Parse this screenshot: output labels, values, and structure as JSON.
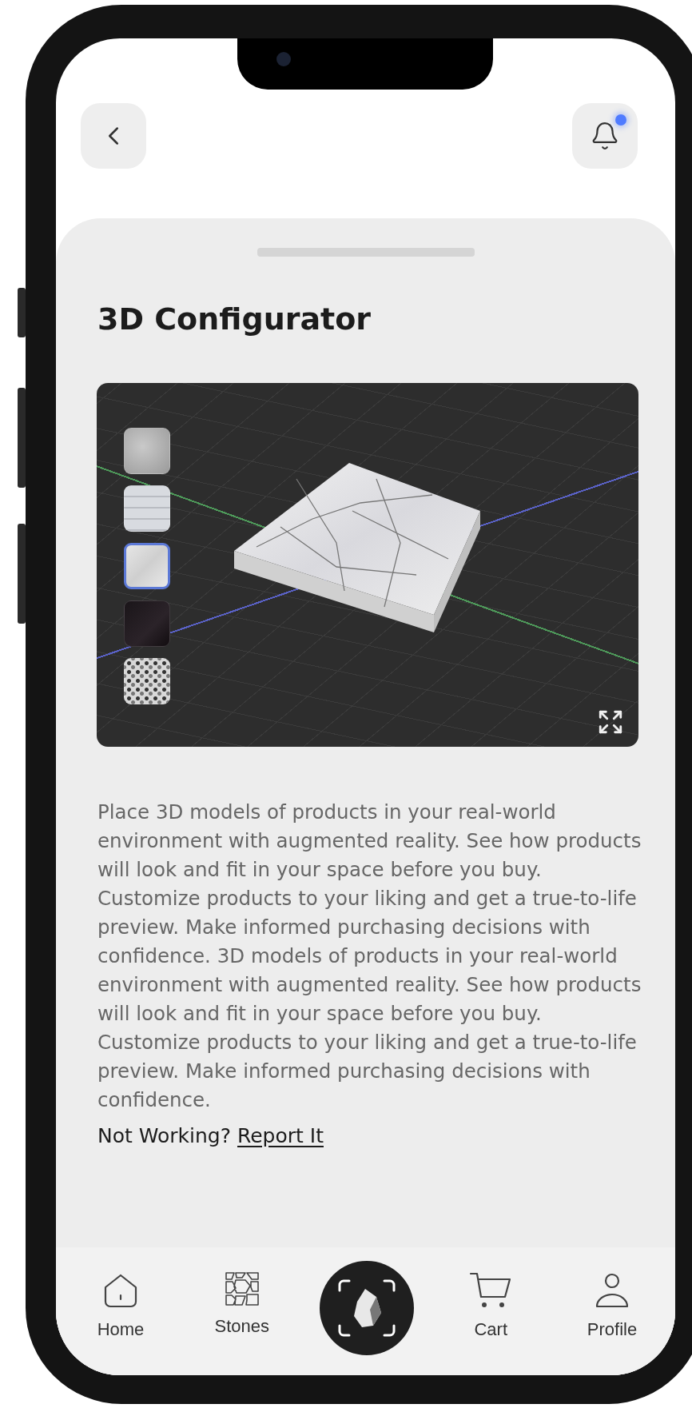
{
  "header": {
    "has_notification": true
  },
  "sheet": {
    "title": "3D Configurator",
    "viewer": {
      "swatches": [
        {
          "kind": "grey",
          "selected": false
        },
        {
          "kind": "striped",
          "selected": false
        },
        {
          "kind": "marble",
          "selected": true
        },
        {
          "kind": "black",
          "selected": false
        },
        {
          "kind": "granite",
          "selected": false
        }
      ]
    },
    "description": "Place 3D models of products in your real-world environment with augmented reality. See how products will look and fit in your space before you buy. Customize products to your liking and get a true-to-life preview. Make informed purchasing decisions with confidence. 3D models of products in your real-world environment with augmented reality. See how products will look and fit in your space before you buy. Customize products to your liking and get a true-to-life preview. Make informed purchasing decisions with confidence.",
    "report": {
      "question": "Not Working?",
      "link": "Report It"
    }
  },
  "nav": [
    {
      "kind": "home",
      "label": "Home"
    },
    {
      "kind": "stones",
      "label": "Stones"
    },
    {
      "kind": "scan"
    },
    {
      "kind": "cart",
      "label": "Cart"
    },
    {
      "kind": "profile",
      "label": "Profile"
    }
  ]
}
